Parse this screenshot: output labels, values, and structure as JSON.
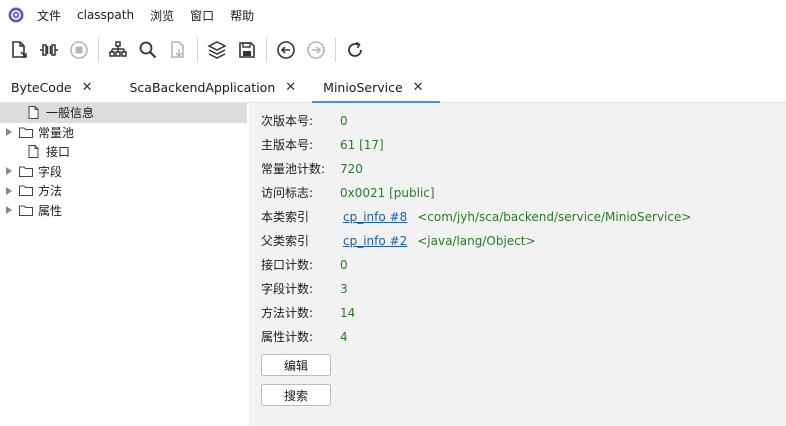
{
  "menu": {
    "items": [
      "文件",
      "classpath",
      "浏览",
      "窗口",
      "帮助"
    ]
  },
  "toolbar": {
    "buttons": [
      {
        "icon": "open-file-icon"
      },
      {
        "icon": "bytecode-icon"
      },
      {
        "icon": "stop-icon"
      },
      {
        "icon": "hierarchy-icon"
      },
      {
        "icon": "search-icon"
      },
      {
        "icon": "download-icon"
      },
      {
        "icon": "layers-icon"
      },
      {
        "icon": "save-icon"
      },
      {
        "icon": "back-icon"
      },
      {
        "icon": "forward-icon"
      },
      {
        "icon": "refresh-icon"
      }
    ]
  },
  "tabs": [
    {
      "label": "ByteCode",
      "close": "✕"
    },
    {
      "label": "ScaBackendApplication",
      "close": "✕"
    },
    {
      "label": "MinioService",
      "close": "✕"
    }
  ],
  "tree": {
    "items": [
      {
        "label": "一般信息",
        "expandable": false
      },
      {
        "label": "常量池",
        "expandable": true
      },
      {
        "label": "接口",
        "expandable": false
      },
      {
        "label": "字段",
        "expandable": true
      },
      {
        "label": "方法",
        "expandable": true
      },
      {
        "label": "属性",
        "expandable": true
      }
    ]
  },
  "info": {
    "minor_version": {
      "label": "次版本号:",
      "value": "0"
    },
    "major_version": {
      "label": "主版本号:",
      "value": "61 [17]"
    },
    "constant_pool_count": {
      "label": "常量池计数:",
      "value": "720"
    },
    "access_flags": {
      "label": "访问标志:",
      "value": "0x0021 [public]"
    },
    "this_class": {
      "label": "本类索引",
      "link": "cp_info #8",
      "value": "<com/jyh/sca/backend/service/MinioService>"
    },
    "super_class": {
      "label": "父类索引",
      "link": "cp_info #2",
      "value": "<java/lang/Object>"
    },
    "interfaces_count": {
      "label": "接口计数:",
      "value": "0"
    },
    "fields_count": {
      "label": "字段计数:",
      "value": "3"
    },
    "methods_count": {
      "label": "方法计数:",
      "value": "14"
    },
    "attributes_count": {
      "label": "属性计数:",
      "value": "4"
    }
  },
  "buttons": {
    "edit": "编辑",
    "search": "搜索"
  },
  "colors": {
    "value_green": "#2a7a2a",
    "link_blue": "#1d5fa8",
    "tab_accent": "#4a90d9",
    "panel_bg": "#f2f2f2",
    "selected_bg": "#dcdcdc"
  }
}
